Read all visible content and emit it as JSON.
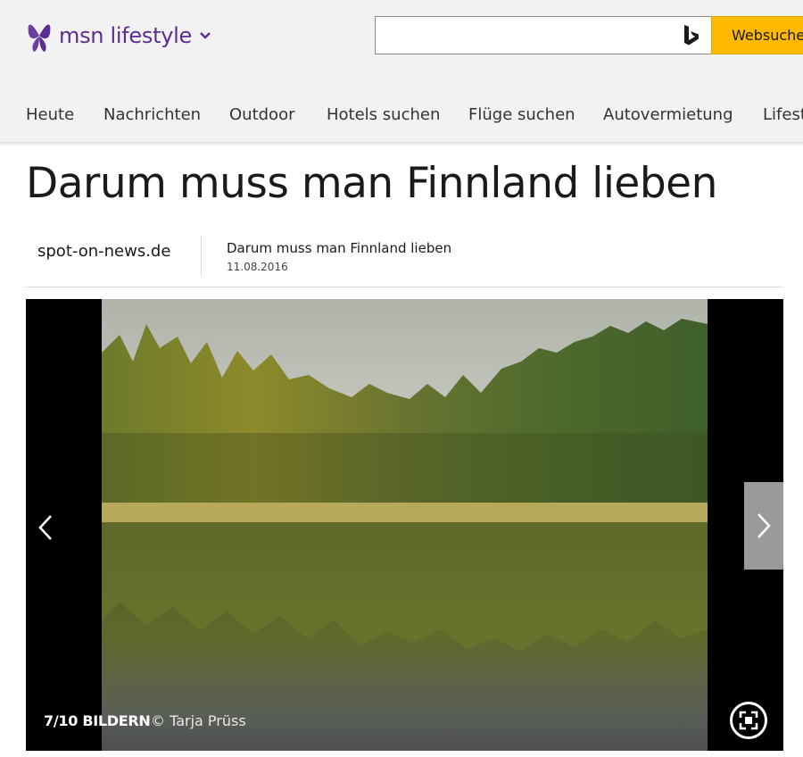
{
  "header": {
    "logo_text": "msn lifestyle",
    "search": {
      "placeholder": "",
      "button_label": "Websuche"
    },
    "nav": [
      "Heute",
      "Nachrichten",
      "Outdoor",
      "Hotels suchen",
      "Flüge suchen",
      "Autovermietung",
      "Lifestyle"
    ]
  },
  "article": {
    "title": "Darum muss man Finnland lieben",
    "source": "spot-on-news.de",
    "subtitle": "Darum muss man Finnland lieben",
    "date": "11.08.2016"
  },
  "gallery": {
    "counter": "7/10 BILDERN",
    "credit": "© Tarja Prüss"
  },
  "icons": {
    "logo": "msn-butterfly-icon",
    "logo_menu": "chevron-down-icon",
    "search_engine": "bing-icon",
    "prev": "chevron-left-icon",
    "next": "chevron-right-icon",
    "fullscreen": "fullscreen-icon"
  },
  "colors": {
    "brand": "#5c2d91",
    "search_button": "#ffb900",
    "header_bg": "#f2f2f2",
    "gallery_bg": "#000000"
  }
}
